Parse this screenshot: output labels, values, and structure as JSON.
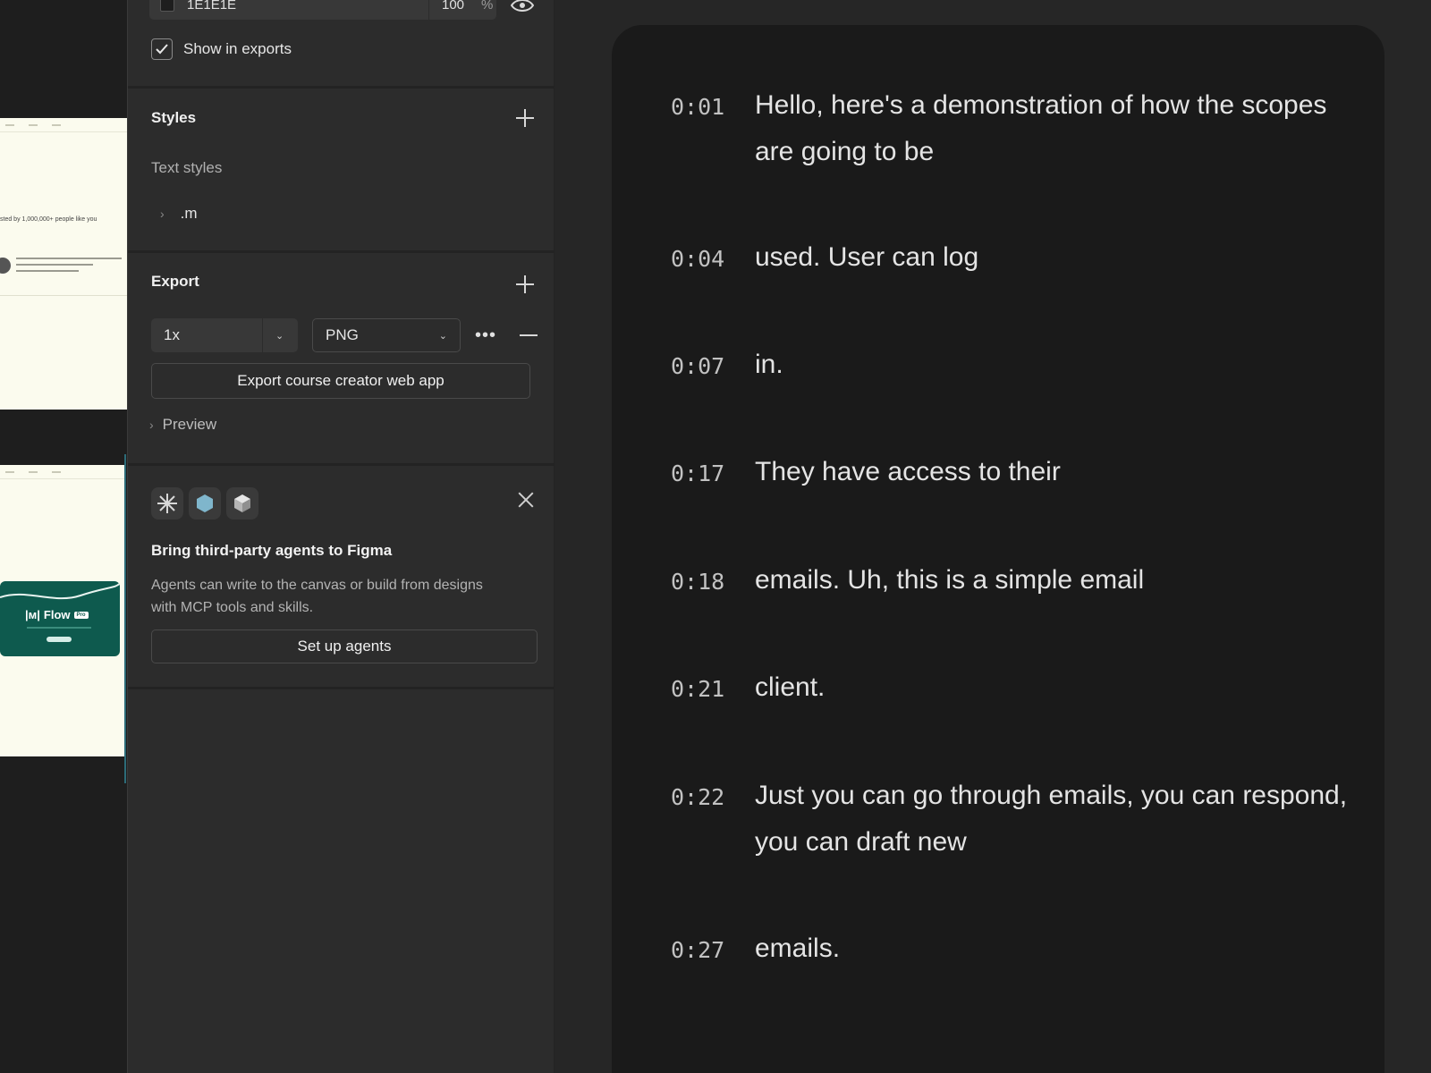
{
  "fill": {
    "hex": "1E1E1E",
    "opacity": "100",
    "unit": "%",
    "show_in_exports_label": "Show in exports",
    "show_in_exports_checked": true
  },
  "styles": {
    "title": "Styles",
    "text_styles_label": "Text styles",
    "items": [
      ".m"
    ]
  },
  "export": {
    "title": "Export",
    "scale": "1x",
    "format": "PNG",
    "button_label": "Export course creator web app",
    "preview_label": "Preview"
  },
  "agents_promo": {
    "title": "Bring third-party agents to Figma",
    "description": "Agents can write to the canvas or build from designs with MCP tools and skills.",
    "button_label": "Set up agents"
  },
  "canvas": {
    "frame1_text": "sted by 1,000,000+ people like you",
    "flow_logo": "Flow",
    "flow_badge": "Pro"
  },
  "transcript": [
    {
      "time": "0:01",
      "text": "Hello, here's a demonstration of how the scopes are going to be"
    },
    {
      "time": "0:04",
      "text": "used. User can log"
    },
    {
      "time": "0:07",
      "text": "in."
    },
    {
      "time": "0:17",
      "text": "They have access to their"
    },
    {
      "time": "0:18",
      "text": "emails. Uh, this is a simple email"
    },
    {
      "time": "0:21",
      "text": "client."
    },
    {
      "time": "0:22",
      "text": "Just you can go through emails, you can respond, you can draft new"
    },
    {
      "time": "0:27",
      "text": "emails."
    }
  ],
  "colors": {
    "panel_bg": "#2c2c2c",
    "transcript_bg": "#1a1a1a",
    "flow_green": "#0e5a4e",
    "selection": "#2c6b78"
  }
}
